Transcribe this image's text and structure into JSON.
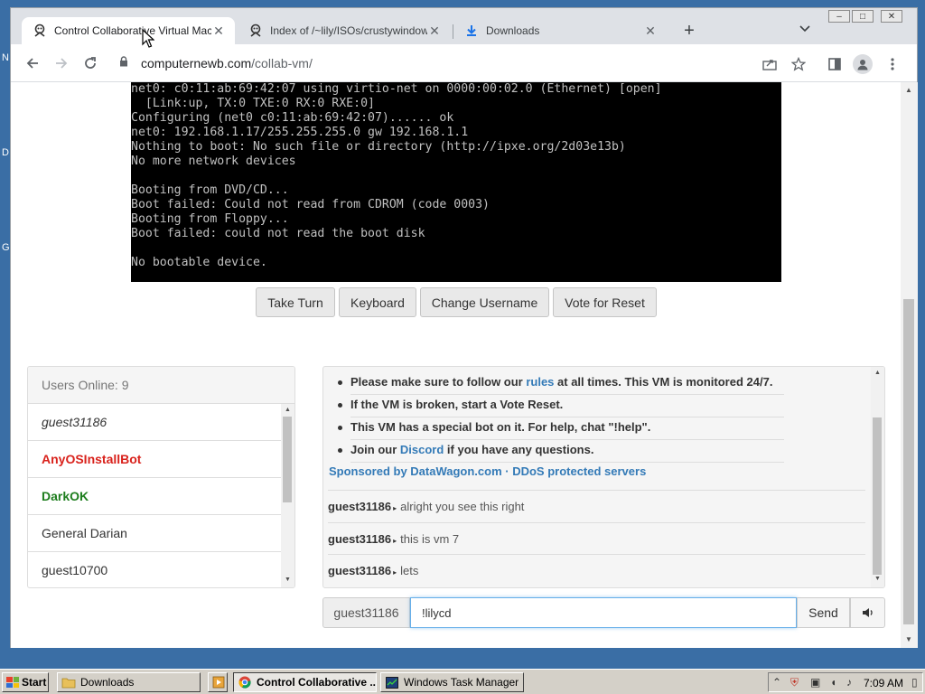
{
  "desktop": {
    "edge_labels": [
      "N",
      "D",
      "G"
    ]
  },
  "browser": {
    "tabs": [
      {
        "title": "Control Collaborative Virtual Machine",
        "icon": "collabvm-icon",
        "active": true
      },
      {
        "title": "Index of /~lily/ISOs/crustywindows/",
        "icon": "collabvm-icon",
        "active": false
      },
      {
        "title": "Downloads",
        "icon": "download-icon",
        "active": false
      }
    ],
    "new_tab_symbol": "+",
    "url_host": "computernewb.com",
    "url_path": "/collab-vm/",
    "window_controls": {
      "minimize": "–",
      "maximize": "□",
      "close": "✕"
    }
  },
  "vm": {
    "screen_lines": [
      "net0: c0:11:ab:69:42:07 using virtio-net on 0000:00:02.0 (Ethernet) [open]",
      "  [Link:up, TX:0 TXE:0 RX:0 RXE:0]",
      "Configuring (net0 c0:11:ab:69:42:07)...... ok",
      "net0: 192.168.1.17/255.255.255.0 gw 192.168.1.1",
      "Nothing to boot: No such file or directory (http://ipxe.org/2d03e13b)",
      "No more network devices",
      "",
      "Booting from DVD/CD...",
      "Boot failed: Could not read from CDROM (code 0003)",
      "Booting from Floppy...",
      "Boot failed: could not read the boot disk",
      "",
      "No bootable device."
    ],
    "buttons": {
      "take_turn": "Take Turn",
      "keyboard": "Keyboard",
      "change_username": "Change Username",
      "vote_reset": "Vote for Reset"
    }
  },
  "users": {
    "header": "Users Online: 9",
    "list": [
      {
        "name": "guest31186",
        "style": "self"
      },
      {
        "name": "AnyOSInstallBot",
        "style": "bot"
      },
      {
        "name": "DarkOK",
        "style": "admin"
      },
      {
        "name": "General Darian",
        "style": "normal"
      },
      {
        "name": "guest10700",
        "style": "normal"
      }
    ]
  },
  "chat": {
    "rules": [
      {
        "pre": "Please make sure to follow our ",
        "link": "rules",
        "post": " at all times. This VM is monitored 24/7."
      },
      {
        "pre": "If the VM is broken, start a Vote Reset.",
        "link": "",
        "post": ""
      },
      {
        "pre": "This VM has a special bot on it. For help, chat \"!help\".",
        "link": "",
        "post": ""
      },
      {
        "pre": "Join our ",
        "link": "Discord",
        "post": " if you have any questions."
      }
    ],
    "sponsor": "Sponsored by DataWagon.com · DDoS protected servers",
    "messages": [
      {
        "user": "guest31186",
        "text": "alright you see this right"
      },
      {
        "user": "guest31186",
        "text": "this is vm 7"
      },
      {
        "user": "guest31186",
        "text": "lets"
      }
    ],
    "input_username": "guest31186",
    "input_value": "!lilycd ",
    "send_label": "Send",
    "sound_icon": "speaker-icon"
  },
  "taskbar": {
    "start_label": "Start",
    "tasks": [
      {
        "label": "Downloads",
        "icon": "folder-icon",
        "active": false
      },
      {
        "label": "Control Collaborative ...",
        "icon": "chrome-icon",
        "active": true
      },
      {
        "label": "Windows Task Manager",
        "icon": "taskmgr-icon",
        "active": false
      }
    ],
    "clock": "7:09 AM"
  },
  "colors": {
    "desktop": "#3a6ea5",
    "bot_user": "#d9221c",
    "admin_user": "#1d7d1d",
    "link": "#337ab7"
  }
}
